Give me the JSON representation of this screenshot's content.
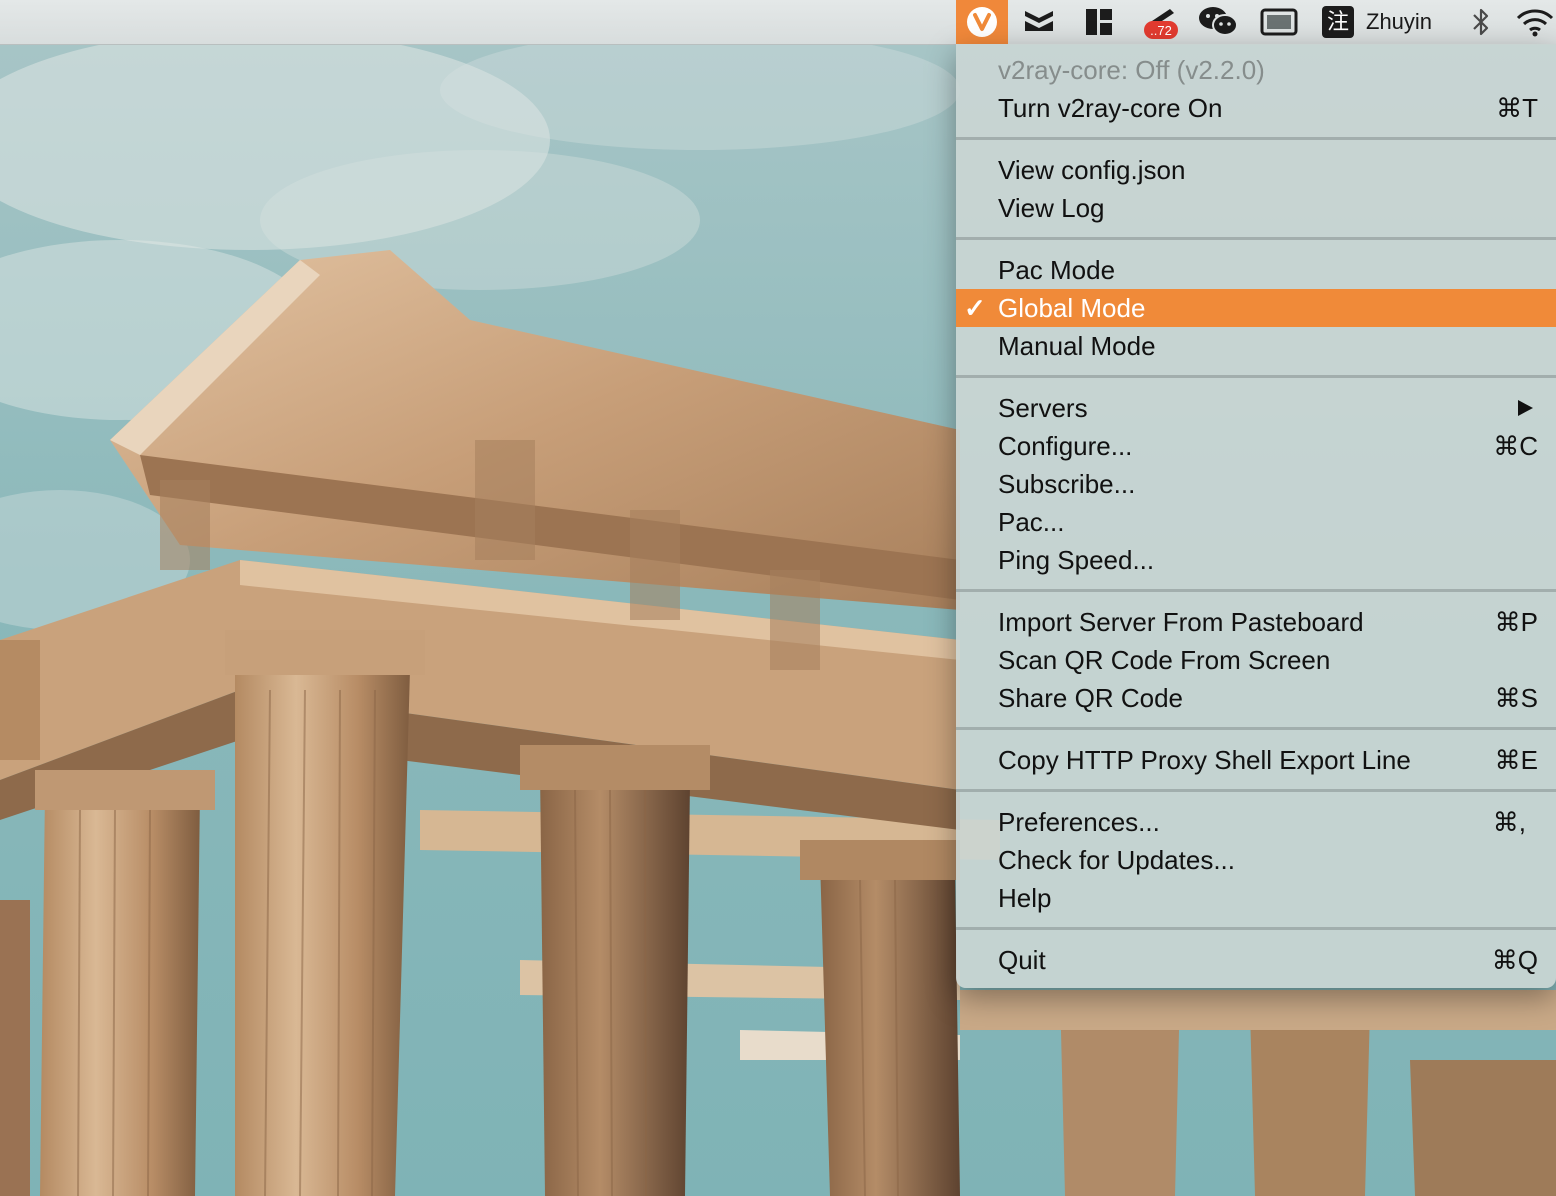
{
  "menubar": {
    "items": [
      {
        "id": "v2ray",
        "icon": "v2ray-u-icon",
        "active": true
      },
      {
        "id": "downloader",
        "icon": "tray-down-icon"
      },
      {
        "id": "layout",
        "icon": "window-layout-icon"
      },
      {
        "id": "monitor",
        "icon": "speed-monitor-icon",
        "badge": "..72"
      },
      {
        "id": "wechat",
        "icon": "wechat-icon"
      },
      {
        "id": "display",
        "icon": "display-icon"
      },
      {
        "id": "input",
        "icon": "zhuyin-icon",
        "text": "Zhuyin"
      },
      {
        "id": "bluetooth",
        "icon": "bluetooth-icon"
      },
      {
        "id": "wifi",
        "icon": "wifi-icon"
      }
    ],
    "badge_text": "..72",
    "input_glyph": "注",
    "input_text": "Zhuyin"
  },
  "menu": {
    "status_label": "v2ray-core: Off  (v2.2.0)",
    "toggle_label": "Turn v2ray-core On",
    "toggle_shortcut": "⌘T",
    "view_config_label": "View config.json",
    "view_log_label": "View Log",
    "pac_mode_label": "Pac Mode",
    "global_mode_label": "Global Mode",
    "global_mode_check": "✓",
    "manual_mode_label": "Manual Mode",
    "servers_label": "Servers",
    "configure_label": "Configure...",
    "configure_shortcut": "⌘C",
    "subscribe_label": "Subscribe...",
    "pac_label": "Pac...",
    "ping_label": "Ping Speed...",
    "import_label": "Import Server From Pasteboard",
    "import_shortcut": "⌘P",
    "scan_label": "Scan QR Code From Screen",
    "share_label": "Share QR Code",
    "share_shortcut": "⌘S",
    "copy_proxy_label": "Copy HTTP Proxy Shell Export Line",
    "copy_proxy_shortcut": "⌘E",
    "preferences_label": "Preferences...",
    "preferences_shortcut": "⌘,",
    "updates_label": "Check for Updates...",
    "help_label": "Help",
    "quit_label": "Quit",
    "quit_shortcut": "⌘Q",
    "selected_mode": "Global Mode"
  },
  "colors": {
    "accent": "#f08a39",
    "menu_bg": "#cbd6d4",
    "sky": "#8fb9bb",
    "stone": "#c8a27e",
    "badge": "#e23b30"
  }
}
